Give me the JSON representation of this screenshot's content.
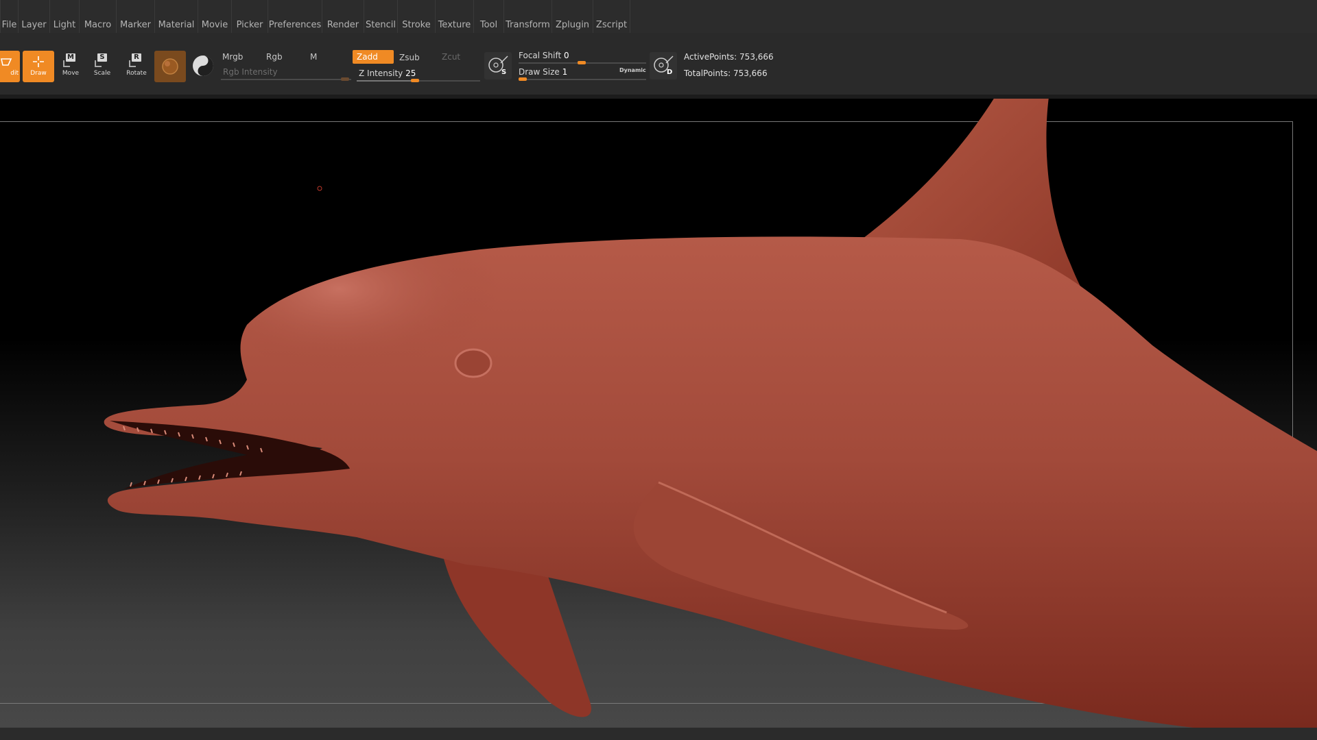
{
  "menu": {
    "items": [
      "File",
      "Layer",
      "Light",
      "Macro",
      "Marker",
      "Material",
      "Movie",
      "Picker",
      "Preferences",
      "Render",
      "Stencil",
      "Stroke",
      "Texture",
      "Tool",
      "Transform",
      "Zplugin",
      "Zscript"
    ]
  },
  "toolbar": {
    "edit_label": "dit",
    "draw_label": "Draw",
    "move_label": "Move",
    "scale_label": "Scale",
    "rotate_label": "Rotate",
    "move_key": "M",
    "scale_key": "S",
    "rotate_key": "R",
    "mrgb_label": "Mrgb",
    "rgb_label": "Rgb",
    "m_label": "M",
    "rgb_intensity_label": "Rgb Intensity",
    "zadd_label": "Zadd",
    "zsub_label": "Zsub",
    "zcut_label": "Zcut",
    "z_intensity_label": "Z Intensity",
    "z_intensity_value": "25",
    "z_intensity_level": 25,
    "focal_shift_label": "Focal Shift",
    "focal_shift_value": "0",
    "draw_size_label": "Draw Size",
    "draw_size_value": "1",
    "dynamic_label": "Dynamic",
    "s_badge": "S",
    "d_badge": "D",
    "active_points_label": "ActivePoints:",
    "active_points_value": "753,666",
    "total_points_label": "TotalPoints:",
    "total_points_value": "753,666"
  },
  "colors": {
    "accent": "#f08a24",
    "model": "#a84a3a",
    "background_top": "#000000",
    "background_bottom": "#484848"
  },
  "viewport": {
    "model": "dolphin sculpt"
  }
}
